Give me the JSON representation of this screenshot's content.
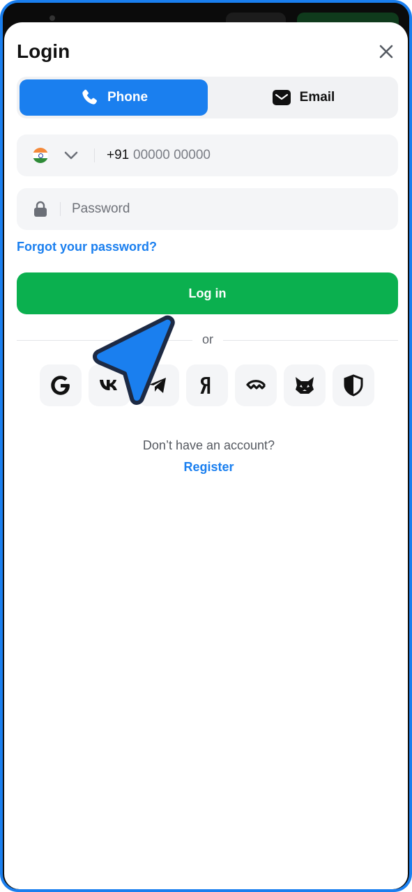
{
  "header": {
    "title": "Login",
    "close_icon": "close-icon"
  },
  "tabs": [
    {
      "label": "Phone",
      "icon": "phone-icon",
      "active": true
    },
    {
      "label": "Email",
      "icon": "mail-icon",
      "active": false
    }
  ],
  "phone_field": {
    "country_flag": "india-flag",
    "dial_code": "+91",
    "placeholder": "00000 00000",
    "value": ""
  },
  "password_field": {
    "placeholder": "Password",
    "value": ""
  },
  "forgot_password_label": "Forgot your password?",
  "login_button_label": "Log in",
  "divider_text": "or",
  "social_buttons": [
    {
      "name": "google",
      "icon": "google-icon"
    },
    {
      "name": "vk",
      "icon": "vk-icon"
    },
    {
      "name": "telegram",
      "icon": "telegram-icon"
    },
    {
      "name": "yandex",
      "icon": "yandex-icon"
    },
    {
      "name": "walletconnect",
      "icon": "walletconnect-icon"
    },
    {
      "name": "metamask",
      "icon": "metamask-fox-icon"
    },
    {
      "name": "shield",
      "icon": "shield-icon"
    }
  ],
  "footer": {
    "no_account_text": "Don’t have an account?",
    "register_label": "Register"
  },
  "colors": {
    "accent": "#1a7fef",
    "login_green": "#0bb04f",
    "frame_border": "#1a7fef"
  }
}
